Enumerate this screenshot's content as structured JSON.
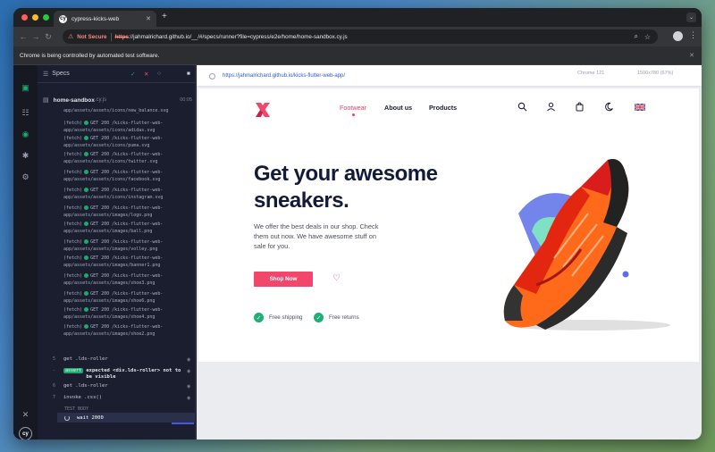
{
  "browser": {
    "tab_title": "cypress-kicks-web",
    "not_secure": "Not Secure",
    "url_scheme": "https",
    "url_rest": "://jahmalrichard.github.io/__/#/specs/runner?file=cypress/e2e/home/home-sandbox.cy.js",
    "infobar": "Chrome is being controlled by automated test software."
  },
  "reporter": {
    "specs_label": "Specs",
    "passed": "✓",
    "failed": "✕",
    "pending": "○",
    "spec_name": "home-sandbox",
    "spec_ext": ".cy.js",
    "spec_time": "00:05",
    "logs": [
      {
        "text": "app/assets/assets/icons/new_balance.svg",
        "fetch": false
      },
      {
        "text": "GET 200 /kicks-flutter-web-app/assets/assets/icons/adidas.svg",
        "fetch": true
      },
      {
        "text": "GET 200 /kicks-flutter-web-app/assets/assets/icons/puma.svg",
        "fetch": true
      },
      {
        "text": "GET 200 /kicks-flutter-web-app/assets/assets/icons/twitter.svg",
        "fetch": true
      },
      {
        "text": "GET 200 /kicks-flutter-web-app/assets/assets/icons/facebook.svg",
        "fetch": true
      },
      {
        "text": "GET 200 /kicks-flutter-web-app/assets/assets/icons/instagram.svg",
        "fetch": true
      },
      {
        "text": "GET 200 /kicks-flutter-web-app/assets/assets/images/logo.png",
        "fetch": true
      },
      {
        "text": "GET 200 /kicks-flutter-web-app/assets/assets/images/ball.png",
        "fetch": true
      },
      {
        "text": "GET 200 /kicks-flutter-web-app/assets/assets/images/volley.png",
        "fetch": true
      },
      {
        "text": "GET 200 /kicks-flutter-web-app/assets/assets/images/banner1.png",
        "fetch": true
      },
      {
        "text": "GET 200 /kicks-flutter-web-app/assets/assets/images/shoe3.png",
        "fetch": true
      },
      {
        "text": "GET 200 /kicks-flutter-web-app/assets/assets/images/shoe6.png",
        "fetch": true
      },
      {
        "text": "GET 200 /kicks-flutter-web-app/assets/assets/images/shoe4.png",
        "fetch": true
      },
      {
        "text": "GET 200 /kicks-flutter-web-app/assets/assets/images/shoe2.png",
        "fetch": true
      }
    ],
    "fetch_label": "(fetch)",
    "cmd_get1_num": "5",
    "cmd_get1": "get  .lds-roller",
    "cmd_assert_badge": "assert",
    "cmd_assert_text": "expected <div.lds-roller> not to be visible",
    "cmd_get2_num": "6",
    "cmd_get2": "get  .lds-roller",
    "cmd_invoke_num": "7",
    "cmd_invoke": "invoke  .css()",
    "test_body": "TEST BODY",
    "wait_cmd": "wait  2000"
  },
  "aut": {
    "url": "https://jahmalrichard.github.io/kicks-flutter-web-app/",
    "browser_name": "Chrome 121",
    "viewport": "1500x780 (67%)"
  },
  "site": {
    "nav": [
      "Footwear",
      "About us",
      "Products"
    ],
    "hero_title_1": "Get your awesome",
    "hero_title_2": "sneakers.",
    "hero_sub": "We offer the best deals in our shop. Check them out now. We have awesome stuff on sale for you.",
    "cta": "Shop Now",
    "features": [
      "Free shipping",
      "Free returns"
    ],
    "accent": "#f2466b",
    "icons": [
      "search-icon",
      "user-icon",
      "bag-icon",
      "moon-icon",
      "uk-flag-icon"
    ]
  }
}
